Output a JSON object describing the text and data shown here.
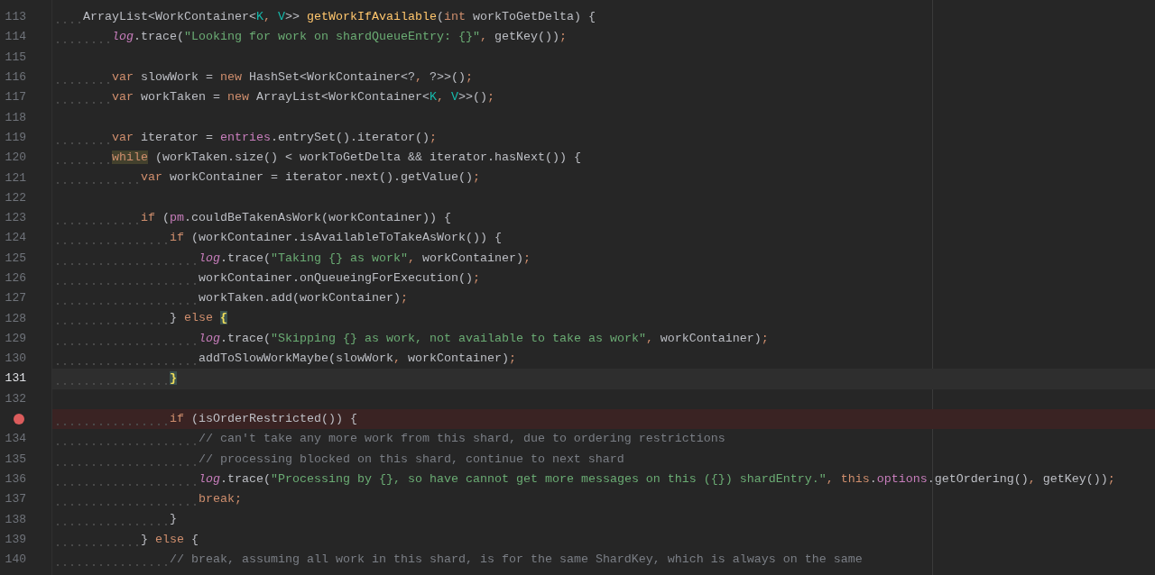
{
  "editor": {
    "lines": [
      {
        "number": "113",
        "tokens": [
          {
            "kind": "p",
            "text": "    ArrayList<WorkContainer<"
          },
          {
            "kind": "tp",
            "text": "K"
          },
          {
            "kind": "punct",
            "text": ", "
          },
          {
            "kind": "tp",
            "text": "V"
          },
          {
            "kind": "p",
            "text": ">> "
          },
          {
            "kind": "decl",
            "text": "getWorkIfAvailable"
          },
          {
            "kind": "p",
            "text": "("
          },
          {
            "kind": "kw",
            "text": "int"
          },
          {
            "kind": "p",
            "text": " workToGetDelta) {"
          }
        ]
      },
      {
        "number": "114",
        "tokens": [
          {
            "kind": "ital",
            "text": "        log"
          },
          {
            "kind": "p",
            "text": ".trace("
          },
          {
            "kind": "str",
            "text": "\"Looking for work on shardQueueEntry: {}\""
          },
          {
            "kind": "punct",
            "text": ","
          },
          {
            "kind": "p",
            "text": " getKey())"
          },
          {
            "kind": "punct",
            "text": ";"
          }
        ]
      },
      {
        "number": "115"
      },
      {
        "number": "116",
        "tokens": [
          {
            "kind": "kw",
            "text": "        var"
          },
          {
            "kind": "p",
            "text": " slowWork = "
          },
          {
            "kind": "kw",
            "text": "new"
          },
          {
            "kind": "p",
            "text": " HashSet<WorkContainer<?"
          },
          {
            "kind": "punct",
            "text": ","
          },
          {
            "kind": "p",
            "text": " ?>>()"
          },
          {
            "kind": "punct",
            "text": ";"
          }
        ]
      },
      {
        "number": "117",
        "tokens": [
          {
            "kind": "kw",
            "text": "        var"
          },
          {
            "kind": "p",
            "text": " workTaken = "
          },
          {
            "kind": "kw",
            "text": "new"
          },
          {
            "kind": "p",
            "text": " ArrayList<WorkContainer<"
          },
          {
            "kind": "tp",
            "text": "K"
          },
          {
            "kind": "punct",
            "text": ", "
          },
          {
            "kind": "tp",
            "text": "V"
          },
          {
            "kind": "p",
            "text": ">>()"
          },
          {
            "kind": "punct",
            "text": ";"
          }
        ]
      },
      {
        "number": "118"
      },
      {
        "number": "119",
        "tokens": [
          {
            "kind": "kw",
            "text": "        var"
          },
          {
            "kind": "p",
            "text": " iterator = "
          },
          {
            "kind": "fld",
            "text": "entries"
          },
          {
            "kind": "p",
            "text": ".entrySet().iterator()"
          },
          {
            "kind": "punct",
            "text": ";"
          }
        ]
      },
      {
        "number": "120",
        "tokens": [
          {
            "kind": "hl",
            "text": "        while"
          },
          {
            "kind": "p",
            "text": " (workTaken.size() < workToGetDelta && iterator.hasNext()) {"
          }
        ]
      },
      {
        "number": "121",
        "tokens": [
          {
            "kind": "kw",
            "text": "            var"
          },
          {
            "kind": "p",
            "text": " workContainer = iterator.next().getValue()"
          },
          {
            "kind": "punct",
            "text": ";"
          }
        ]
      },
      {
        "number": "122"
      },
      {
        "number": "123",
        "tokens": [
          {
            "kind": "kw",
            "text": "            if"
          },
          {
            "kind": "p",
            "text": " ("
          },
          {
            "kind": "fld",
            "text": "pm"
          },
          {
            "kind": "p",
            "text": ".couldBeTakenAsWork(workContainer)) {"
          }
        ]
      },
      {
        "number": "124",
        "tokens": [
          {
            "kind": "kw",
            "text": "                if"
          },
          {
            "kind": "p",
            "text": " (workContainer.isAvailableToTakeAsWork()) {"
          }
        ]
      },
      {
        "number": "125",
        "tokens": [
          {
            "kind": "ital",
            "text": "                    log"
          },
          {
            "kind": "p",
            "text": ".trace("
          },
          {
            "kind": "str",
            "text": "\"Taking {} as work\""
          },
          {
            "kind": "punct",
            "text": ","
          },
          {
            "kind": "p",
            "text": " workContainer)"
          },
          {
            "kind": "punct",
            "text": ";"
          }
        ]
      },
      {
        "number": "126",
        "tokens": [
          {
            "kind": "p",
            "text": "                    workContainer.onQueueingForExecution()"
          },
          {
            "kind": "punct",
            "text": ";"
          }
        ]
      },
      {
        "number": "127",
        "tokens": [
          {
            "kind": "p",
            "text": "                    workTaken.add(workContainer)"
          },
          {
            "kind": "punct",
            "text": ";"
          }
        ]
      },
      {
        "number": "128",
        "tokens": [
          {
            "kind": "p",
            "text": "                } "
          },
          {
            "kind": "kw",
            "text": "else "
          },
          {
            "kind": "brace",
            "text": "{"
          }
        ]
      },
      {
        "number": "129",
        "tokens": [
          {
            "kind": "ital",
            "text": "                    log"
          },
          {
            "kind": "p",
            "text": ".trace("
          },
          {
            "kind": "str",
            "text": "\"Skipping {} as work, not available to take as work\""
          },
          {
            "kind": "punct",
            "text": ","
          },
          {
            "kind": "p",
            "text": " workContainer)"
          },
          {
            "kind": "punct",
            "text": ";"
          }
        ]
      },
      {
        "number": "130",
        "tokens": [
          {
            "kind": "p",
            "text": "                    addToSlowWorkMaybe(slowWork"
          },
          {
            "kind": "punct",
            "text": ","
          },
          {
            "kind": "p",
            "text": " workContainer)"
          },
          {
            "kind": "punct",
            "text": ";"
          }
        ]
      },
      {
        "number": "131",
        "current": true,
        "tokens": [
          {
            "kind": "brace",
            "text": "                }"
          }
        ]
      },
      {
        "number": "132"
      },
      {
        "breakpoint": true,
        "tokens": [
          {
            "kind": "kw",
            "text": "                if"
          },
          {
            "kind": "p",
            "text": " (isOrderRestricted()) {"
          }
        ]
      },
      {
        "number": "134",
        "tokens": [
          {
            "kind": "cm",
            "text": "                    // can't take any more work from this shard, due to ordering restrictions"
          }
        ]
      },
      {
        "number": "135",
        "tokens": [
          {
            "kind": "cm",
            "text": "                    // processing blocked on this shard, continue to next shard"
          }
        ]
      },
      {
        "number": "136",
        "tokens": [
          {
            "kind": "ital",
            "text": "                    log"
          },
          {
            "kind": "p",
            "text": ".trace("
          },
          {
            "kind": "str",
            "text": "\"Processing by {}, so have cannot get more messages on this ({}) shardEntry.\""
          },
          {
            "kind": "punct",
            "text": ", "
          },
          {
            "kind": "kw",
            "text": "this"
          },
          {
            "kind": "p",
            "text": "."
          },
          {
            "kind": "fld",
            "text": "options"
          },
          {
            "kind": "p",
            "text": ".getOrdering()"
          },
          {
            "kind": "punct",
            "text": ","
          },
          {
            "kind": "p",
            "text": " getKey())"
          },
          {
            "kind": "punct",
            "text": ";"
          }
        ]
      },
      {
        "number": "137",
        "tokens": [
          {
            "kind": "kw",
            "text": "                    break"
          },
          {
            "kind": "punct",
            "text": ";"
          }
        ]
      },
      {
        "number": "138",
        "tokens": [
          {
            "kind": "p",
            "text": "                }"
          }
        ]
      },
      {
        "number": "139",
        "tokens": [
          {
            "kind": "p",
            "text": "            } "
          },
          {
            "kind": "kw",
            "text": "else"
          },
          {
            "kind": "p",
            "text": " {"
          }
        ]
      },
      {
        "number": "140",
        "tokens": [
          {
            "kind": "cm",
            "text": "                // break, assuming all work in this shard, is for the same ShardKey, which is always on the same"
          }
        ]
      }
    ]
  }
}
